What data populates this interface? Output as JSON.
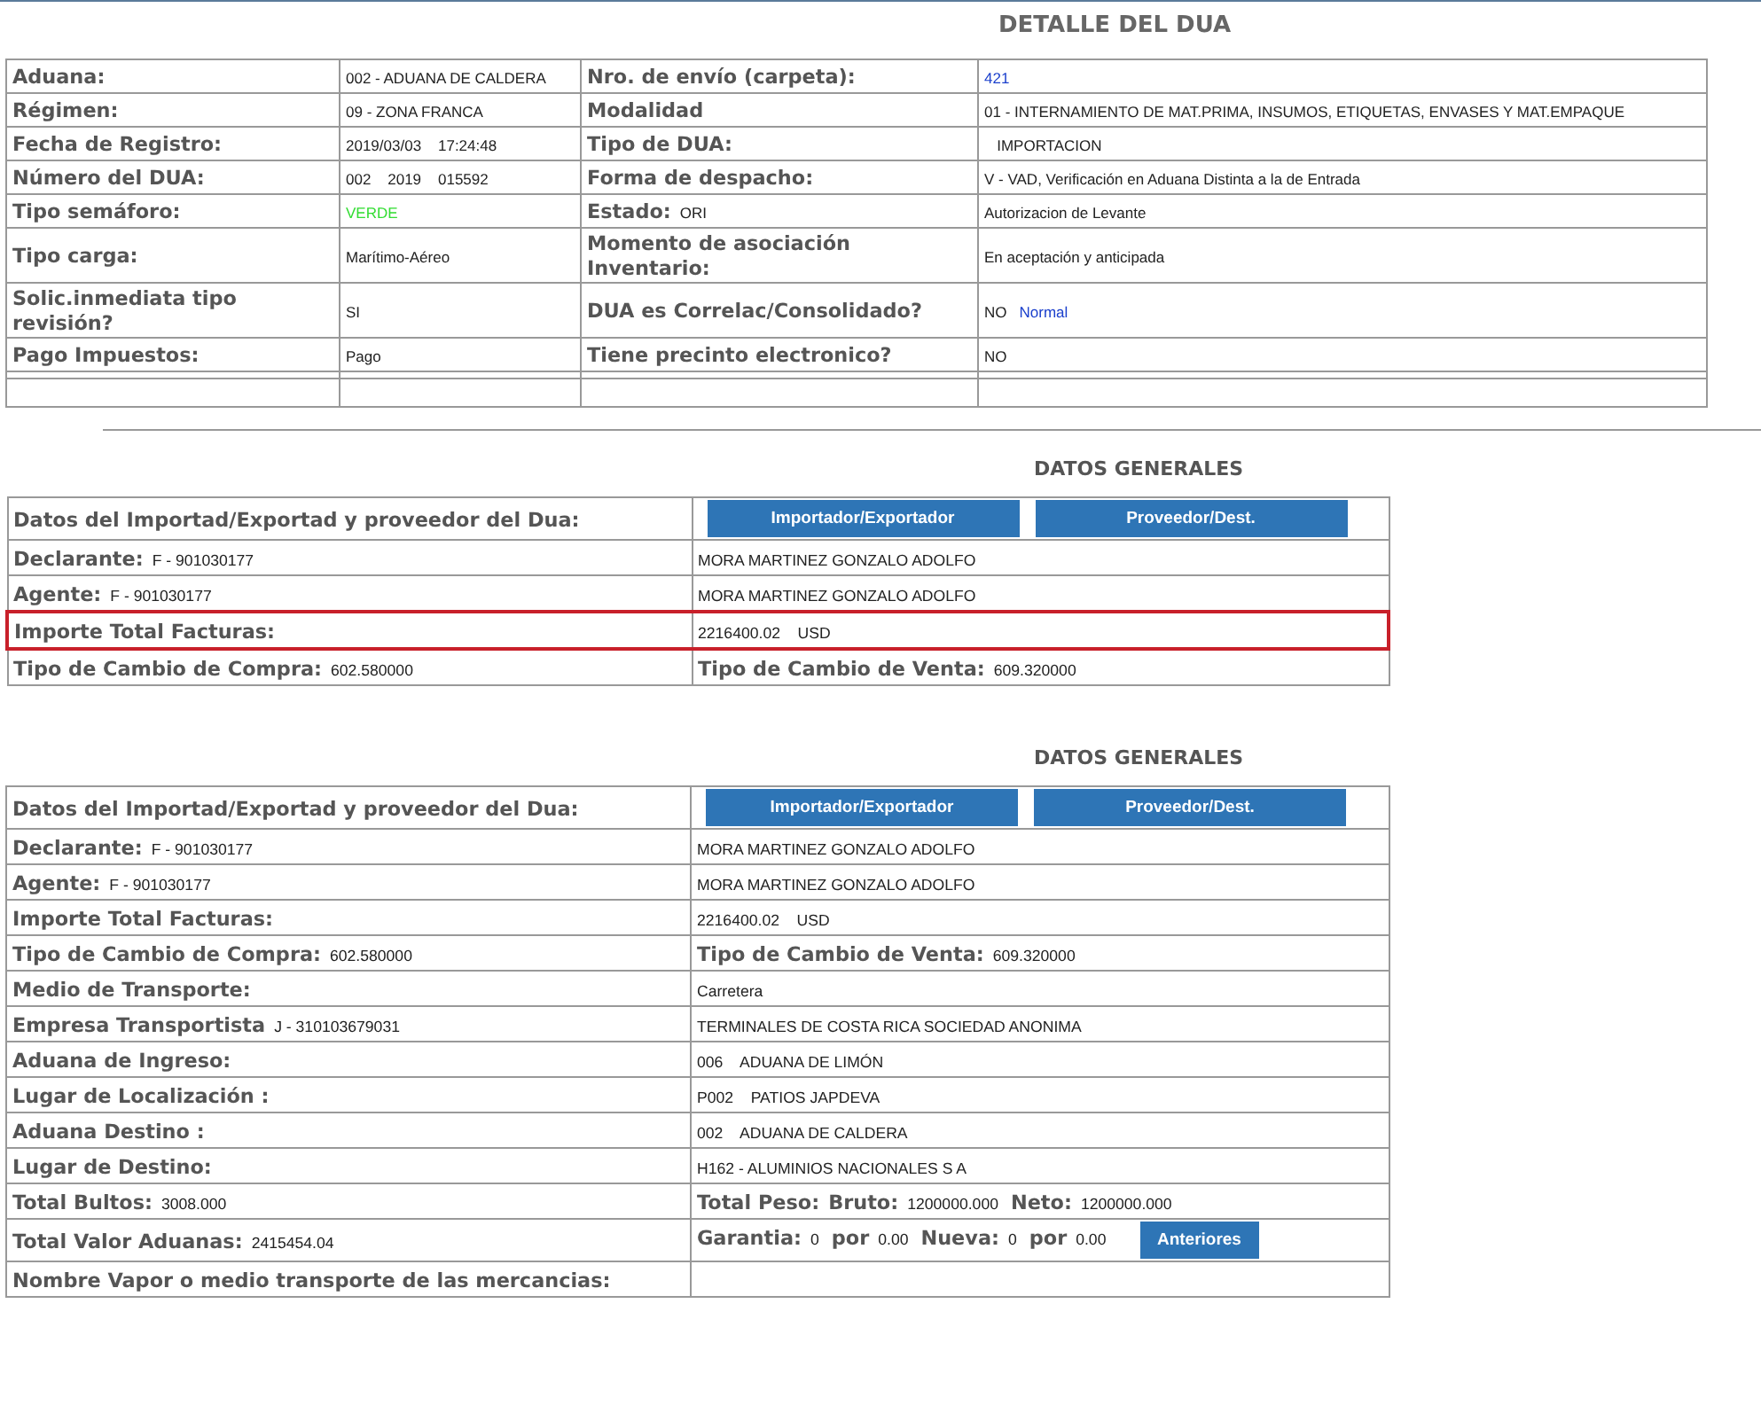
{
  "title": "DETALLE DEL DUA",
  "detail_table": {
    "rows": [
      {
        "cells": [
          [
            {
              "kind": "label",
              "text": "Aduana:"
            }
          ],
          [
            {
              "kind": "value",
              "text": "002 - ADUANA DE CALDERA"
            }
          ],
          [
            {
              "kind": "label",
              "text": "Nro. de envío (carpeta):"
            }
          ],
          [
            {
              "kind": "link",
              "text": "421"
            }
          ]
        ]
      },
      {
        "cells": [
          [
            {
              "kind": "label",
              "text": "Régimen:"
            }
          ],
          [
            {
              "kind": "value",
              "text": "09 - ZONA FRANCA"
            }
          ],
          [
            {
              "kind": "label",
              "text": "Modalidad"
            }
          ],
          [
            {
              "kind": "value",
              "text": "01 - INTERNAMIENTO DE MAT.PRIMA, INSUMOS, ETIQUETAS, ENVASES Y MAT.EMPAQUE"
            }
          ]
        ]
      },
      {
        "cells": [
          [
            {
              "kind": "label",
              "text": "Fecha de Registro:"
            }
          ],
          [
            {
              "kind": "value",
              "text": "2019/03/03    17:24:48"
            }
          ],
          [
            {
              "kind": "label",
              "text": "Tipo de DUA:"
            }
          ],
          [
            {
              "kind": "value",
              "text": "   IMPORTACION"
            }
          ]
        ]
      },
      {
        "cells": [
          [
            {
              "kind": "label",
              "text": "Número del DUA:"
            }
          ],
          [
            {
              "kind": "value",
              "text": "002    2019    015592"
            }
          ],
          [
            {
              "kind": "label",
              "text": "Forma de despacho:"
            }
          ],
          [
            {
              "kind": "value",
              "text": "V - VAD, Verificación en Aduana Distinta a la de Entrada"
            }
          ]
        ]
      },
      {
        "cells": [
          [
            {
              "kind": "label",
              "text": "Tipo semáforo:"
            }
          ],
          [
            {
              "kind": "status",
              "text": "VERDE",
              "color": "#33dd33"
            }
          ],
          [
            {
              "kind": "label",
              "text": "Estado:"
            },
            {
              "kind": "value",
              "text": "ORI"
            }
          ],
          [
            {
              "kind": "value",
              "text": "Autorizacion de Levante"
            }
          ]
        ]
      },
      {
        "cells": [
          [
            {
              "kind": "label",
              "text": "Tipo carga:"
            }
          ],
          [
            {
              "kind": "value",
              "text": "Marítimo-Aéreo"
            }
          ],
          [
            {
              "kind": "label",
              "text": "Momento de asociación Inventario:"
            }
          ],
          [
            {
              "kind": "value",
              "text": "En aceptación y anticipada"
            }
          ]
        ]
      },
      {
        "cells": [
          [
            {
              "kind": "label",
              "text": "Solic.inmediata tipo revisión?"
            }
          ],
          [
            {
              "kind": "value",
              "text": "SI"
            }
          ],
          [
            {
              "kind": "label",
              "text": "DUA es Correlac/Consolidado?"
            }
          ],
          [
            {
              "kind": "value",
              "text": "NO"
            },
            {
              "kind": "link",
              "text": "Normal"
            }
          ]
        ]
      },
      {
        "cells": [
          [
            {
              "kind": "label",
              "text": "Pago Impuestos:"
            }
          ],
          [
            {
              "kind": "value",
              "text": "Pago"
            }
          ],
          [
            {
              "kind": "label",
              "text": "Tiene precinto electronico?"
            }
          ],
          [
            {
              "kind": "value",
              "text": "NO"
            }
          ]
        ]
      }
    ]
  },
  "sections": [
    {
      "title": "DATOS GENERALES",
      "rows": [
        {
          "highlighted": false,
          "cells": [
            [
              {
                "kind": "label",
                "text": "Datos del Importad/Exportad y proveedor del Dua:"
              }
            ],
            [
              {
                "kind": "button",
                "text": "Importador/Exportador"
              },
              {
                "kind": "button",
                "text": "Proveedor/Dest."
              }
            ]
          ]
        },
        {
          "highlighted": false,
          "cells": [
            [
              {
                "kind": "label",
                "text": "Declarante:"
              },
              {
                "kind": "value",
                "text": "F - 901030177"
              }
            ],
            [
              {
                "kind": "value",
                "text": "MORA MARTINEZ GONZALO ADOLFO"
              }
            ]
          ]
        },
        {
          "highlighted": false,
          "cells": [
            [
              {
                "kind": "label",
                "text": "Agente:"
              },
              {
                "kind": "value",
                "text": "F - 901030177"
              }
            ],
            [
              {
                "kind": "value",
                "text": "MORA MARTINEZ GONZALO ADOLFO"
              }
            ]
          ]
        },
        {
          "highlighted": true,
          "cells": [
            [
              {
                "kind": "label",
                "text": "Importe Total Facturas:"
              }
            ],
            [
              {
                "kind": "value",
                "text": "2216400.02    USD"
              }
            ]
          ]
        },
        {
          "highlighted": false,
          "cells": [
            [
              {
                "kind": "label",
                "text": "Tipo de Cambio de Compra:"
              },
              {
                "kind": "value",
                "text": "602.580000"
              }
            ],
            [
              {
                "kind": "label",
                "text": "Tipo de Cambio de Venta:"
              },
              {
                "kind": "value",
                "text": "609.320000"
              }
            ]
          ]
        }
      ]
    },
    {
      "title": "DATOS GENERALES",
      "rows": [
        {
          "highlighted": false,
          "cells": [
            [
              {
                "kind": "label",
                "text": "Datos del Importad/Exportad y proveedor del Dua:"
              }
            ],
            [
              {
                "kind": "button",
                "text": "Importador/Exportador"
              },
              {
                "kind": "button",
                "text": "Proveedor/Dest."
              }
            ]
          ]
        },
        {
          "highlighted": false,
          "cells": [
            [
              {
                "kind": "label",
                "text": "Declarante:"
              },
              {
                "kind": "value",
                "text": "F - 901030177"
              }
            ],
            [
              {
                "kind": "value",
                "text": "MORA MARTINEZ GONZALO ADOLFO"
              }
            ]
          ]
        },
        {
          "highlighted": false,
          "cells": [
            [
              {
                "kind": "label",
                "text": "Agente:"
              },
              {
                "kind": "value",
                "text": "F - 901030177"
              }
            ],
            [
              {
                "kind": "value",
                "text": "MORA MARTINEZ GONZALO ADOLFO"
              }
            ]
          ]
        },
        {
          "highlighted": false,
          "cells": [
            [
              {
                "kind": "label",
                "text": "Importe Total Facturas:"
              }
            ],
            [
              {
                "kind": "value",
                "text": "2216400.02    USD"
              }
            ]
          ]
        },
        {
          "highlighted": false,
          "cells": [
            [
              {
                "kind": "label",
                "text": "Tipo de Cambio de Compra:"
              },
              {
                "kind": "value",
                "text": "602.580000"
              }
            ],
            [
              {
                "kind": "label",
                "text": "Tipo de Cambio de Venta:"
              },
              {
                "kind": "value",
                "text": "609.320000"
              }
            ]
          ]
        },
        {
          "highlighted": false,
          "cells": [
            [
              {
                "kind": "label",
                "text": "Medio de Transporte:"
              }
            ],
            [
              {
                "kind": "value",
                "text": "Carretera"
              }
            ]
          ]
        },
        {
          "highlighted": false,
          "cells": [
            [
              {
                "kind": "label",
                "text": "Empresa Transportista"
              },
              {
                "kind": "value",
                "text": "J - 310103679031"
              }
            ],
            [
              {
                "kind": "value",
                "text": "TERMINALES DE COSTA RICA SOCIEDAD ANONIMA"
              }
            ]
          ]
        },
        {
          "highlighted": false,
          "cells": [
            [
              {
                "kind": "label",
                "text": "Aduana de Ingreso:"
              }
            ],
            [
              {
                "kind": "value",
                "text": "006    ADUANA DE LIMÓN"
              }
            ]
          ]
        },
        {
          "highlighted": false,
          "cells": [
            [
              {
                "kind": "label",
                "text": "Lugar de Localización :"
              }
            ],
            [
              {
                "kind": "value",
                "text": "P002    PATIOS JAPDEVA"
              }
            ]
          ]
        },
        {
          "highlighted": false,
          "cells": [
            [
              {
                "kind": "label",
                "text": "Aduana Destino :"
              }
            ],
            [
              {
                "kind": "value",
                "text": "002    ADUANA DE CALDERA"
              }
            ]
          ]
        },
        {
          "highlighted": false,
          "cells": [
            [
              {
                "kind": "label",
                "text": "Lugar de Destino:"
              }
            ],
            [
              {
                "kind": "value",
                "text": "H162 - ALUMINIOS NACIONALES S A"
              }
            ]
          ]
        },
        {
          "highlighted": false,
          "cells": [
            [
              {
                "kind": "label",
                "text": "Total Bultos:"
              },
              {
                "kind": "value",
                "text": "3008.000"
              }
            ],
            [
              {
                "kind": "label",
                "text": "Total Peso:"
              },
              {
                "kind": "label",
                "text": "Bruto:"
              },
              {
                "kind": "value",
                "text": "1200000.000"
              },
              {
                "kind": "label",
                "text": "Neto:"
              },
              {
                "kind": "value",
                "text": "1200000.000"
              }
            ]
          ]
        },
        {
          "highlighted": false,
          "cells": [
            [
              {
                "kind": "label",
                "text": "Total Valor Aduanas:"
              },
              {
                "kind": "value",
                "text": "2415454.04"
              }
            ],
            [
              {
                "kind": "label",
                "text": "Garantia:"
              },
              {
                "kind": "value",
                "text": "0"
              },
              {
                "kind": "label",
                "text": "por"
              },
              {
                "kind": "value",
                "text": "0.00"
              },
              {
                "kind": "label",
                "text": "Nueva:"
              },
              {
                "kind": "value",
                "text": "0"
              },
              {
                "kind": "label",
                "text": "por"
              },
              {
                "kind": "value",
                "text": "0.00"
              },
              {
                "kind": "button",
                "text": "Anteriores"
              }
            ]
          ]
        },
        {
          "highlighted": false,
          "cells": [
            [
              {
                "kind": "label",
                "text": "Nombre Vapor o medio transporte de las mercancias:"
              }
            ],
            []
          ]
        }
      ]
    }
  ]
}
